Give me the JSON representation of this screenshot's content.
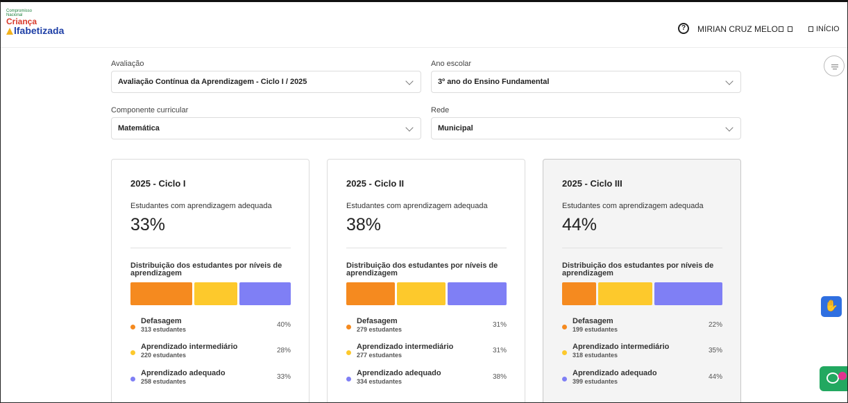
{
  "logo": {
    "line1": "Compromisso",
    "line2": "Nacional",
    "line3": "Criança",
    "line4": "lfabetizada"
  },
  "header": {
    "help_icon": "question-circle-icon",
    "user_name": "MIRIAN CRUZ MELO",
    "home_label": "INÍCIO"
  },
  "filters": {
    "avaliacao": {
      "label": "Avaliação",
      "value": "Avaliação Contínua da Aprendizagem - Ciclo I / 2025"
    },
    "ano_escolar": {
      "label": "Ano escolar",
      "value": "3º ano do Ensino Fundamental"
    },
    "componente": {
      "label": "Componente curricular",
      "value": "Matemática"
    },
    "rede": {
      "label": "Rede",
      "value": "Municipal"
    }
  },
  "cards": [
    {
      "title": "2025 - Ciclo I",
      "subtitle": "Estudantes com aprendizagem adequada",
      "percent": "33%",
      "dist_title": "Distribuição dos estudantes por níveis de aprendizagem",
      "levels": [
        {
          "name": "Defasagem",
          "count": "313 estudantes",
          "pct": "40%",
          "value": 40
        },
        {
          "name": "Aprendizado intermediário",
          "count": "220 estudantes",
          "pct": "28%",
          "value": 28
        },
        {
          "name": "Aprendizado adequado",
          "count": "258 estudantes",
          "pct": "33%",
          "value": 33
        }
      ]
    },
    {
      "title": "2025 - Ciclo II",
      "subtitle": "Estudantes com aprendizagem adequada",
      "percent": "38%",
      "dist_title": "Distribuição dos estudantes por níveis de aprendizagem",
      "levels": [
        {
          "name": "Defasagem",
          "count": "279 estudantes",
          "pct": "31%",
          "value": 31
        },
        {
          "name": "Aprendizado intermediário",
          "count": "277 estudantes",
          "pct": "31%",
          "value": 31
        },
        {
          "name": "Aprendizado adequado",
          "count": "334 estudantes",
          "pct": "38%",
          "value": 38
        }
      ]
    },
    {
      "title": "2025 - Ciclo III",
      "subtitle": "Estudantes com aprendizagem adequada",
      "percent": "44%",
      "dist_title": "Distribuição dos estudantes por níveis de aprendizagem",
      "levels": [
        {
          "name": "Defasagem",
          "count": "199 estudantes",
          "pct": "22%",
          "value": 22
        },
        {
          "name": "Aprendizado intermediário",
          "count": "318 estudantes",
          "pct": "35%",
          "value": 35
        },
        {
          "name": "Aprendizado adequado",
          "count": "399 estudantes",
          "pct": "44%",
          "value": 44
        }
      ]
    }
  ],
  "colors": {
    "defasagem": "#f58a1f",
    "intermediario": "#fdc92c",
    "adequado": "#7f7ff5"
  },
  "icons": {
    "accessibility": "sign-language-icon",
    "chat": "chat-bubble-icon",
    "filter": "filter-icon"
  }
}
